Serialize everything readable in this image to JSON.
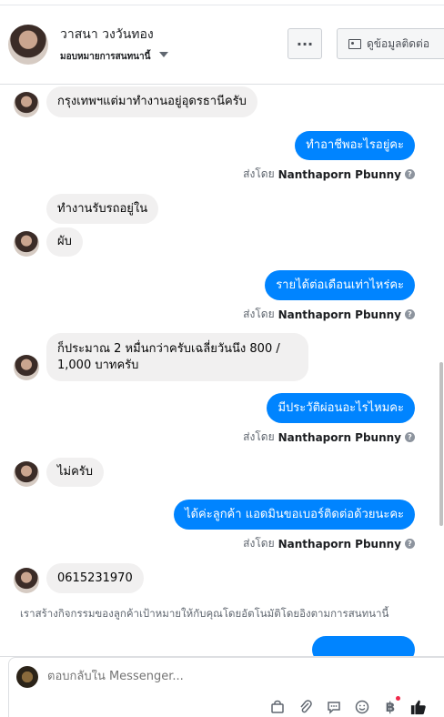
{
  "header": {
    "contact_name": "วาสนา วงวันทอง",
    "contact_sub": "มอบหมายการสนทนานี้",
    "more_label": "···",
    "profile_label": "ดูข้อมูลติดต่อ"
  },
  "messages": {
    "m1": "กรุงเทพฯแต่มาทำงานอยู่อุดรธานีครับ",
    "m2": "ทำอาชีพอะไรอยู่คะ",
    "m3": "ทำงานรับรถอยู่ใน",
    "m4": "ผับ",
    "m5": "รายได้ต่อเดือนเท่าไหร่คะ",
    "m6": "ก็ประมาณ 2 หมื่นกว่าครับเฉลี่ยวันนึง 800 / 1,000 บาทครับ",
    "m7": "มีประวัติผ่อนอะไรไหมคะ",
    "m8": "ไม่ครับ",
    "m9": "ได้ค่ะลูกค้า แอดมินขอเบอร์ติดต่อด้วยนะคะ",
    "m10": "0615231970"
  },
  "sent_by": {
    "prefix": "ส่งโดย",
    "name": "Nanthaporn Pbunny",
    "help_icon": "?"
  },
  "notice": "เราสร้างกิจกรรมของลูกค้าเป้าหมายให้กับคุณโดยอัตโนมัติโดยอิงตามการสนทนานี้",
  "composer": {
    "placeholder": "ตอบกลับใน Messenger...",
    "tools": [
      "bag-icon",
      "attachment-icon",
      "chat-icon",
      "emoji-icon",
      "baht-icon",
      "like-icon"
    ]
  },
  "colors": {
    "outgoing_bubble": "#0084ff",
    "incoming_bubble": "#f1f0f0",
    "like": "#1c1e21"
  }
}
